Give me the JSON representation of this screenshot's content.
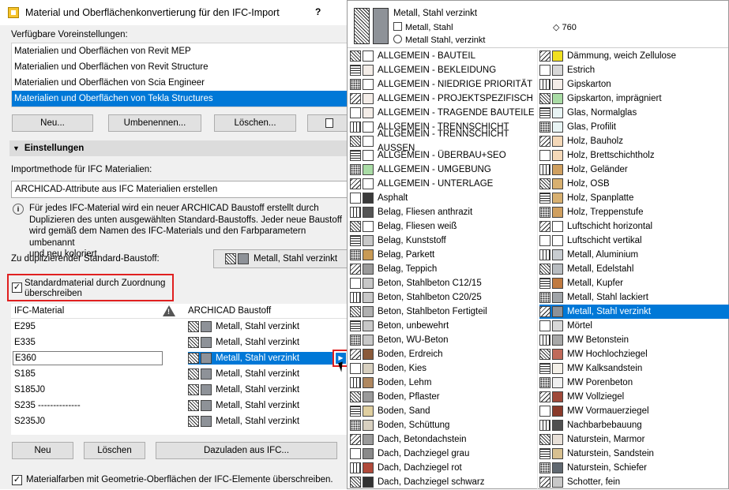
{
  "dialog": {
    "title": "Material und Oberflächenkonvertierung für den IFC-Import",
    "help": "?",
    "presets_label": "Verfügbare Voreinstellungen:",
    "presets": [
      "Materialien und Oberflächen von Revit MEP",
      "Materialien und Oberflächen von Revit Structure",
      "Materialien und Oberflächen von Scia Engineer",
      "Materialien und Oberflächen von Tekla Structures"
    ],
    "selected_preset": 3,
    "buttons": {
      "new": "Neu...",
      "rename": "Umbenennen...",
      "delete": "Löschen..."
    },
    "settings_header": "Einstellungen",
    "import_method_label": "Importmethode für IFC Materialien:",
    "import_method_value": "ARCHICAD-Attribute aus IFC Materialien erstellen",
    "info_lines": [
      "Für jedes IFC-Material wird ein neuer ARCHICAD Baustoff erstellt durch",
      "Duplizieren des unten ausgewählten Standard-Baustoffs. Jeder neue Baustoff",
      "wird gemäß dem Namen des IFC-Materials und den Farbparametern umbenannt",
      "und neu koloriert."
    ],
    "std_material_label": "Zu duplizierender Standard-Baustoff:",
    "std_material_value": "Metall, Stahl verzinkt",
    "checkbox_standard_lines": [
      "Standardmaterial durch Zuordnung",
      "überschreiben"
    ],
    "table": {
      "col_ifc": "IFC-Material",
      "col_archicad": "ARCHICAD Baustoff",
      "rows": [
        {
          "ifc": "E295",
          "ac": "Metall, Stahl verzinkt"
        },
        {
          "ifc": "E335",
          "ac": "Metall, Stahl verzinkt"
        },
        {
          "ifc": "E360",
          "ac": "Metall, Stahl verzinkt"
        },
        {
          "ifc": "S185",
          "ac": "Metall, Stahl verzinkt"
        },
        {
          "ifc": "S185J0",
          "ac": "Metall, Stahl verzinkt"
        },
        {
          "ifc": "S235 --------------",
          "ac": "Metall, Stahl verzinkt"
        },
        {
          "ifc": "S235J0",
          "ac": "Metall, Stahl verzinkt"
        }
      ],
      "selected_row": 2
    },
    "bottom_buttons": {
      "new": "Neu",
      "delete": "Löschen",
      "reload": "Dazuladen aus IFC..."
    },
    "bottom_checkbox": "Materialfarben mit Geometrie-Oberflächen der IFC-Elemente überschreiben."
  },
  "popup": {
    "header": {
      "name": "Metall, Stahl verzinkt",
      "line2": "Metall, Stahl",
      "line3": "Metall Stahl, verzinkt",
      "index": "760"
    },
    "left": [
      {
        "n": "ALLGEMEIN - BAUTEIL",
        "c": "#ffffff"
      },
      {
        "n": "ALLGEMEIN - BEKLEIDUNG",
        "c": "#f4ede8"
      },
      {
        "n": "ALLGEMEIN - NIEDRIGE PRIORITÄT",
        "c": "#ffffff"
      },
      {
        "n": "ALLGEMEIN - PROJEKTSPEZIFISCH",
        "c": "#f4ede8"
      },
      {
        "n": "ALLGEMEIN - TRAGENDE BAUTEILE",
        "c": "#f4ede8"
      },
      {
        "n": "ALLGEMEIN - TRENNSCHICHT",
        "c": "#ffffff"
      },
      {
        "n": "ALLGEMEIN - TRENNSCHICHT AUSSEN",
        "c": "#ffffff"
      },
      {
        "n": "ALLGEMEIN - ÜBERBAU+SEO",
        "c": "#ffffff"
      },
      {
        "n": "ALLGEMEIN - UMGEBUNG",
        "c": "#a9dca5"
      },
      {
        "n": "ALLGEMEIN - UNTERLAGE",
        "c": "#ffffff"
      },
      {
        "n": "Asphalt",
        "c": "#3a3a3a"
      },
      {
        "n": "Belag, Fliesen anthrazit",
        "c": "#555555"
      },
      {
        "n": "Belag, Fliesen weiß",
        "c": "#ffffff"
      },
      {
        "n": "Belag, Kunststoff",
        "c": "#c8c8c8"
      },
      {
        "n": "Belag, Parkett",
        "c": "#c89a55"
      },
      {
        "n": "Belag, Teppich",
        "c": "#9a9a9a"
      },
      {
        "n": "Beton, Stahlbeton C12/15",
        "c": "#c8c8c8"
      },
      {
        "n": "Beton, Stahlbeton C20/25",
        "c": "#c8c8c8"
      },
      {
        "n": "Beton, Stahlbeton Fertigteil",
        "c": "#b0b0b0"
      },
      {
        "n": "Beton, unbewehrt",
        "c": "#c8c8c8"
      },
      {
        "n": "Beton, WU-Beton",
        "c": "#c8c8c8"
      },
      {
        "n": "Boden, Erdreich",
        "c": "#8a5a3a"
      },
      {
        "n": "Boden, Kies",
        "c": "#d8d0c0"
      },
      {
        "n": "Boden, Lehm",
        "c": "#b08860"
      },
      {
        "n": "Boden, Pflaster",
        "c": "#9a9a9a"
      },
      {
        "n": "Boden, Sand",
        "c": "#e0cfa0"
      },
      {
        "n": "Boden, Schüttung",
        "c": "#d8d0c0"
      },
      {
        "n": "Dach, Betondachstein",
        "c": "#9a9a9a"
      },
      {
        "n": "Dach, Dachziegel grau",
        "c": "#8a8a8a"
      },
      {
        "n": "Dach, Dachziegel rot",
        "c": "#b04a3a"
      },
      {
        "n": "Dach, Dachziegel schwarz",
        "c": "#333333"
      }
    ],
    "right": [
      {
        "n": "Dämmung, weich Zellulose",
        "c": "#f0e020"
      },
      {
        "n": "Estrich",
        "c": "#d8d8d8"
      },
      {
        "n": "Gipskarton",
        "c": "#f4ede8"
      },
      {
        "n": "Gipskarton, imprägniert",
        "c": "#a9dca5"
      },
      {
        "n": "Glas, Normalglas",
        "c": "#e8f4f4"
      },
      {
        "n": "Glas, Profilit",
        "c": "#e8f4f4"
      },
      {
        "n": "Holz, Bauholz",
        "c": "#f4d8b8"
      },
      {
        "n": "Holz, Brettschichtholz",
        "c": "#f4d8b8"
      },
      {
        "n": "Holz, Geländer",
        "c": "#d0a060"
      },
      {
        "n": "Holz, OSB",
        "c": "#d8b070"
      },
      {
        "n": "Holz, Spanplatte",
        "c": "#d8b070"
      },
      {
        "n": "Holz, Treppenstufe",
        "c": "#d0a060"
      },
      {
        "n": "Luftschicht horizontal",
        "c": "#ffffff"
      },
      {
        "n": "Luftschicht vertikal",
        "c": "#ffffff"
      },
      {
        "n": "Metall, Aluminium",
        "c": "#c8ccd0"
      },
      {
        "n": "Metall, Edelstahl",
        "c": "#b8bcc0"
      },
      {
        "n": "Metall, Kupfer",
        "c": "#c07a40"
      },
      {
        "n": "Metall, Stahl lackiert",
        "c": "#a0a4a8"
      },
      {
        "n": "Metall, Stahl verzinkt",
        "c": "#8e9298"
      },
      {
        "n": "Mörtel",
        "c": "#d8d8d8"
      },
      {
        "n": "MW Betonstein",
        "c": "#a8a8a8"
      },
      {
        "n": "MW Hochlochziegel",
        "c": "#c06a5a"
      },
      {
        "n": "MW Kalksandstein",
        "c": "#f4f0e8"
      },
      {
        "n": "MW Porenbeton",
        "c": "#f0f0f0"
      },
      {
        "n": "MW Vollziegel",
        "c": "#a04a3a"
      },
      {
        "n": "MW Vormauerziegel",
        "c": "#8a3a2a"
      },
      {
        "n": "Nachbarbebauung",
        "c": "#505050"
      },
      {
        "n": "Naturstein, Marmor",
        "c": "#e8e0d8"
      },
      {
        "n": "Naturstein, Sandstein",
        "c": "#d8c090"
      },
      {
        "n": "Naturstein, Schiefer",
        "c": "#606870"
      },
      {
        "n": "Schotter, fein",
        "c": "#c8c8c8"
      }
    ],
    "selected_right": 18
  }
}
